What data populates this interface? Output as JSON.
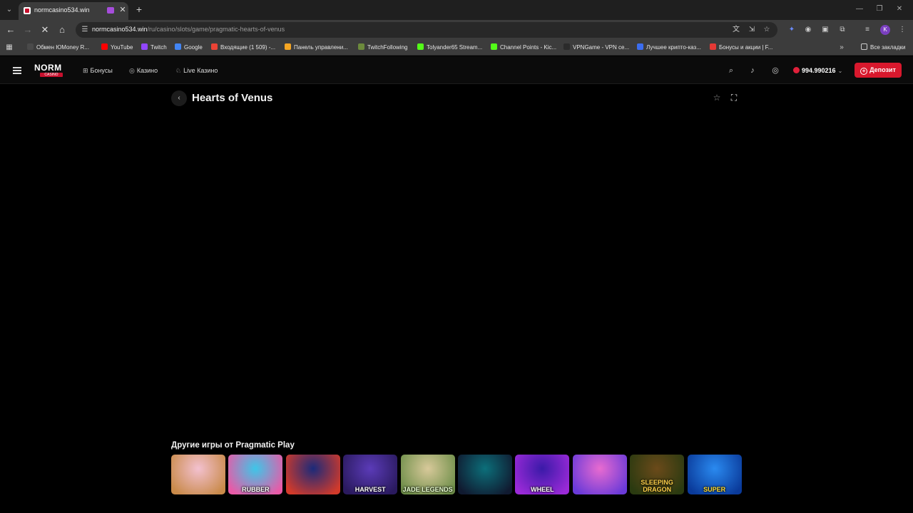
{
  "browser": {
    "tab_title": "normcasino534.win",
    "url_host": "normcasino534.win",
    "url_path": "/ru/casino/slots/game/pragmatic-hearts-of-venus",
    "profile_initial": "K",
    "bookmarks": [
      {
        "label": "Обмен ЮMoney R...",
        "color": "#4a4a4a"
      },
      {
        "label": "YouTube",
        "color": "#ff0000"
      },
      {
        "label": "Twitch",
        "color": "#9146ff"
      },
      {
        "label": "Google",
        "color": "#4285f4"
      },
      {
        "label": "Входящие (1 509) -...",
        "color": "#ea4335"
      },
      {
        "label": "Панель управлени...",
        "color": "#f5a623"
      },
      {
        "label": "TwitchFollowing",
        "color": "#6c8a3c"
      },
      {
        "label": "Tolyander65 Stream...",
        "color": "#53fc18"
      },
      {
        "label": "Channel Points - Kic...",
        "color": "#53fc18"
      },
      {
        "label": "VPNGame - VPN ce...",
        "color": "#2b2b2b"
      },
      {
        "label": "Лучшее крипто-каз...",
        "color": "#3b6df0"
      },
      {
        "label": "Бонусы и акции | F...",
        "color": "#e53935"
      }
    ],
    "all_bookmarks_label": "Все закладки"
  },
  "site": {
    "logo_word": "NORM",
    "logo_sub": "CASINO",
    "nav": [
      {
        "label": "Бонусы",
        "icon": "gift-icon"
      },
      {
        "label": "Казино",
        "icon": "casino-chip-icon"
      },
      {
        "label": "Live Казино",
        "icon": "live-icon"
      }
    ],
    "balance": "994.990216",
    "deposit_label": "Депозит",
    "accent": "#d8182d"
  },
  "game": {
    "title": "Hearts of Venus"
  },
  "more_games": {
    "title": "Другие игры от Pragmatic Play",
    "thumbs": [
      {
        "caption": "",
        "colors": [
          "#f3c1d0",
          "#c98a4a"
        ],
        "cap_color": "#ffd86b"
      },
      {
        "caption": "RUBBER",
        "colors": [
          "#3ec6e8",
          "#e85aa7"
        ],
        "cap_color": "#ffffff"
      },
      {
        "caption": "",
        "colors": [
          "#1b2a7a",
          "#d23a2a"
        ],
        "cap_color": "#ffcc33"
      },
      {
        "caption": "HARVEST",
        "colors": [
          "#5b3bb8",
          "#2a1a5e"
        ],
        "cap_color": "#ffffff"
      },
      {
        "caption": "JADE LEGENDS",
        "colors": [
          "#d8c99a",
          "#6f8f4a"
        ],
        "cap_color": "#e8ffd0"
      },
      {
        "caption": "",
        "colors": [
          "#0c6f7a",
          "#101a30"
        ],
        "cap_color": "#ff3b3b"
      },
      {
        "caption": "WHEEL",
        "colors": [
          "#3a1aa8",
          "#9b2ad8"
        ],
        "cap_color": "#ffffff"
      },
      {
        "caption": "",
        "colors": [
          "#e86bd0",
          "#6a3ad8"
        ],
        "cap_color": "#ffffff"
      },
      {
        "caption": "SLEEPING DRAGON",
        "colors": [
          "#6b4a1a",
          "#2a3a10"
        ],
        "cap_color": "#ffd24a"
      },
      {
        "caption": "SUPER",
        "colors": [
          "#2a8af0",
          "#0a3a9a"
        ],
        "cap_color": "#ffdd33"
      }
    ]
  }
}
